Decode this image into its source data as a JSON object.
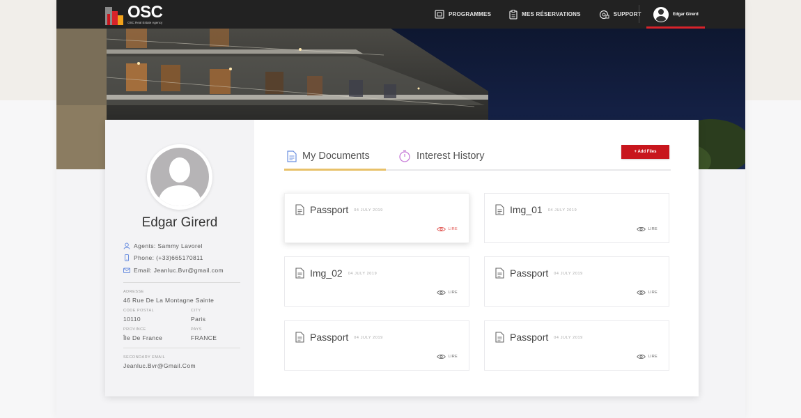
{
  "app": {
    "logo_title": "OSC",
    "logo_subtitle": "OSC Real Estate Agency"
  },
  "nav": {
    "items": [
      {
        "label": "PROGRAMMES",
        "icon": "book-icon"
      },
      {
        "label": "MES RÉSERVATIONS",
        "icon": "clipboard-icon"
      },
      {
        "label": "SUPPORT",
        "icon": "support-icon"
      }
    ],
    "user_name": "Edgar Girerd"
  },
  "profile": {
    "name": "Edgar Girerd",
    "agent": "Agents: Sammy Lavorel",
    "phone": "Phone: (+33)665170811",
    "email": "Email: Jeanluc.Bvr@gmail.com",
    "address_label": "ADRESSE",
    "address": "46 Rue De La Montagne Sainte",
    "postal_label": "CODE POSTAL",
    "postal": "10110",
    "city_label": "CITY",
    "city": "Paris",
    "province_label": "PROVINCE",
    "province": "Île De France",
    "country_label": "PAYS",
    "country": "FRANCE",
    "secondary_email_label": "SECONDARY EMAIL",
    "secondary_email": "Jeanluc.Bvr@Gmail.Com"
  },
  "tabs": {
    "documents": "My Documents",
    "history": "Interest History",
    "active": "documents"
  },
  "add_files_label": "+ Add Files",
  "documents": [
    {
      "name": "Passport",
      "date": "04 JULY 2019",
      "action": "LIRE"
    },
    {
      "name": "Img_01",
      "date": "04 JULY 2019",
      "action": "LIRE"
    },
    {
      "name": "Img_02",
      "date": "04 JULY 2019",
      "action": "LIRE"
    },
    {
      "name": "Passport",
      "date": "04 JULY 2019",
      "action": "LIRE"
    },
    {
      "name": "Passport",
      "date": "04 JULY 2019",
      "action": "LIRE"
    },
    {
      "name": "Passport",
      "date": "04 JULY 2019",
      "action": "LIRE"
    }
  ],
  "colors": {
    "accent_red": "#c8161d",
    "tab_underline": "#e8c169",
    "navbar": "#222222"
  }
}
